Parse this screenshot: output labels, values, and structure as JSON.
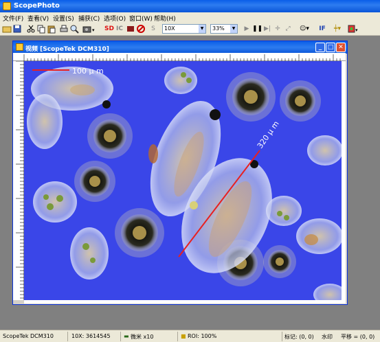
{
  "app": {
    "title": "ScopePhoto"
  },
  "menu": [
    {
      "label": "文件(F)"
    },
    {
      "label": "查看(V)"
    },
    {
      "label": "设置(S)"
    },
    {
      "label": "捕获(C)"
    },
    {
      "label": "选项(O)"
    },
    {
      "label": "窗口(W)"
    },
    {
      "label": "帮助(H)"
    }
  ],
  "toolbar": {
    "sd_label": "SD",
    "ic_label": "IC",
    "s_label": "S",
    "if_label": "IF",
    "objective_value": "10X",
    "zoom_value": "33%"
  },
  "child_window": {
    "title": "视频 [ScopeTek DCM310]"
  },
  "measurements": [
    {
      "label": "100 μ m"
    },
    {
      "label": "320 μ m"
    }
  ],
  "status": {
    "device": "ScopeTek DCM310",
    "resolution": "10X: 3614545",
    "unit": "微米 x10",
    "roi": "ROI: 100%",
    "mark": "标记: (0, 0)",
    "watermark": "水印",
    "pan": "平移 = (0, 0)"
  },
  "colors": {
    "background_blue": "#3a46e8",
    "measure_line": "#e82020",
    "titlebar": "#0a5ee8"
  }
}
